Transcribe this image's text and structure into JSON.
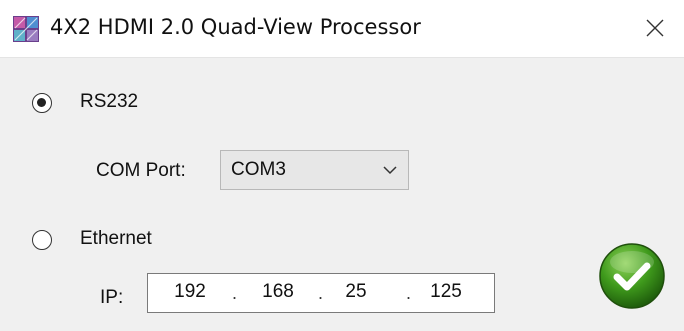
{
  "window": {
    "title": "4X2 HDMI 2.0 Quad-View Processor",
    "app_icon": "quad-view-app-icon",
    "close_icon": "close-icon"
  },
  "connection": {
    "selected": "RS232",
    "rs232": {
      "label": "RS232",
      "checked": true,
      "com_port_label": "COM Port:",
      "com_port_value": "COM3"
    },
    "ethernet": {
      "label": "Ethernet",
      "checked": false,
      "ip_label": "IP:",
      "ip_octets": [
        "192",
        "168",
        "25",
        "125"
      ],
      "ip_separator": "."
    }
  },
  "ok_button": {
    "icon": "checkmark-icon",
    "color": "#3f9a1c"
  }
}
